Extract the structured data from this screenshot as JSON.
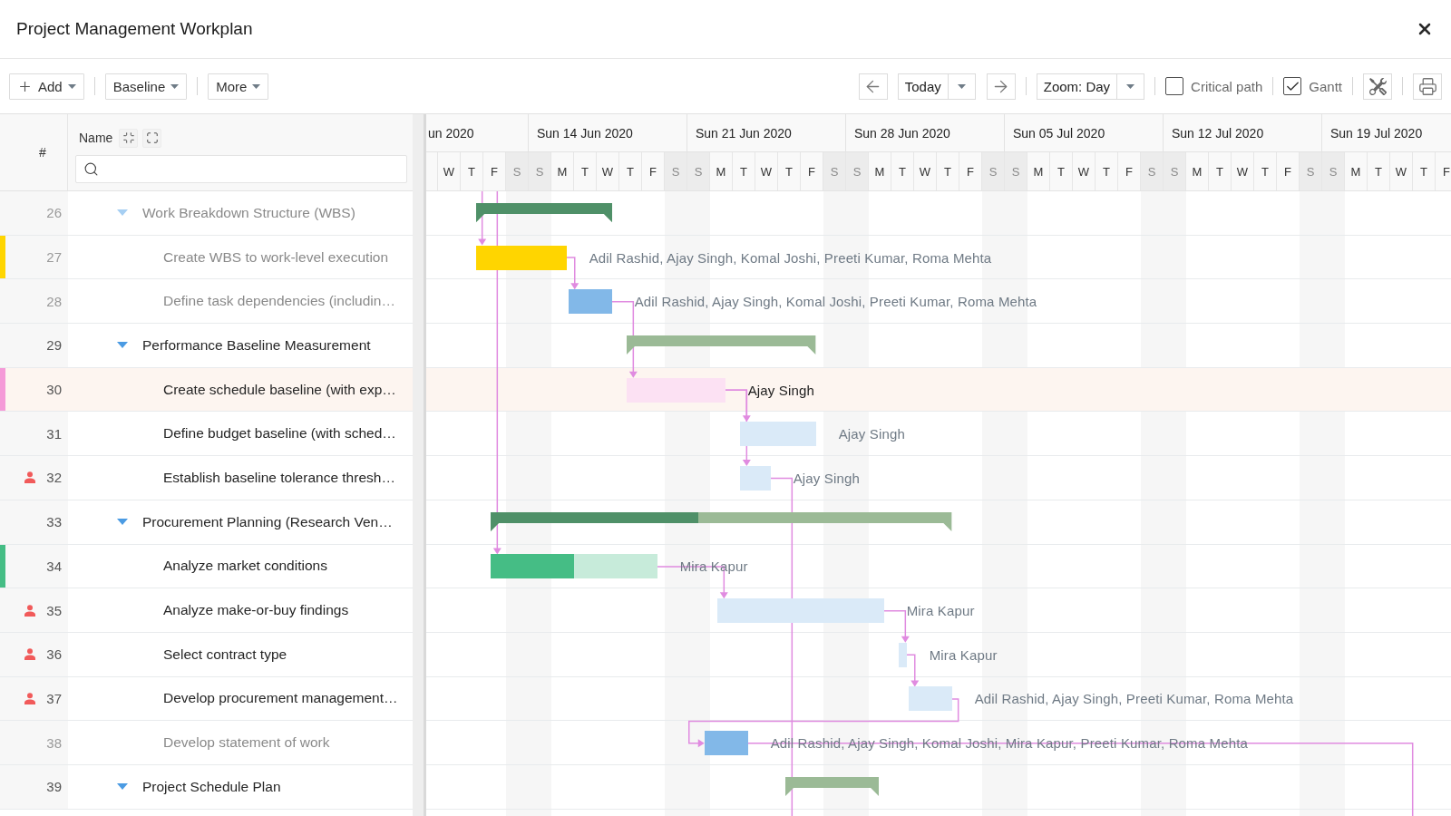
{
  "window": {
    "title": "Project Management Workplan"
  },
  "toolbar": {
    "buttons": [
      {
        "kind": "add",
        "label": "Add"
      },
      {
        "kind": "menu",
        "label": "Baseline"
      },
      {
        "kind": "menu",
        "label": "More"
      }
    ],
    "today": {
      "label": "Today"
    },
    "zoom": {
      "label": "Zoom: Day"
    },
    "checkboxes": [
      {
        "label": "Critical path",
        "checked": false
      },
      {
        "label": "Gantt",
        "checked": true
      }
    ]
  },
  "grid": {
    "columns": [
      "#",
      "Name"
    ]
  },
  "timeline": {
    "weeks": [
      "un 2020",
      "Sun 14 Jun 2020",
      "Sun 21 Jun 2020",
      "Sun 28 Jun 2020",
      "Sun 05 Jul 2020",
      "Sun 12 Jul 2020",
      "Sun 19 Jul 2020"
    ],
    "days": [
      {
        "letter": "W",
        "weekend": false
      },
      {
        "letter": "T",
        "weekend": false
      },
      {
        "letter": "F",
        "weekend": false
      },
      {
        "letter": "S",
        "weekend": true
      },
      {
        "letter": "S",
        "weekend": true
      },
      {
        "letter": "M",
        "weekend": false
      },
      {
        "letter": "T",
        "weekend": false
      },
      {
        "letter": "W",
        "weekend": false
      },
      {
        "letter": "T",
        "weekend": false
      },
      {
        "letter": "F",
        "weekend": false
      },
      {
        "letter": "S",
        "weekend": true
      },
      {
        "letter": "S",
        "weekend": true
      },
      {
        "letter": "M",
        "weekend": false
      },
      {
        "letter": "T",
        "weekend": false
      },
      {
        "letter": "W",
        "weekend": false
      },
      {
        "letter": "T",
        "weekend": false
      },
      {
        "letter": "F",
        "weekend": false
      },
      {
        "letter": "S",
        "weekend": true
      },
      {
        "letter": "S",
        "weekend": true
      },
      {
        "letter": "M",
        "weekend": false
      },
      {
        "letter": "T",
        "weekend": false
      },
      {
        "letter": "W",
        "weekend": false
      },
      {
        "letter": "T",
        "weekend": false
      },
      {
        "letter": "F",
        "weekend": false
      },
      {
        "letter": "S",
        "weekend": true
      },
      {
        "letter": "S",
        "weekend": true
      },
      {
        "letter": "M",
        "weekend": false
      },
      {
        "letter": "T",
        "weekend": false
      },
      {
        "letter": "W",
        "weekend": false
      },
      {
        "letter": "T",
        "weekend": false
      },
      {
        "letter": "F",
        "weekend": false
      },
      {
        "letter": "S",
        "weekend": true
      },
      {
        "letter": "S",
        "weekend": true
      },
      {
        "letter": "M",
        "weekend": false
      },
      {
        "letter": "T",
        "weekend": false
      },
      {
        "letter": "W",
        "weekend": false
      },
      {
        "letter": "T",
        "weekend": false
      },
      {
        "letter": "F",
        "weekend": false
      },
      {
        "letter": "S",
        "weekend": true
      },
      {
        "letter": "S",
        "weekend": true
      },
      {
        "letter": "M",
        "weekend": false
      },
      {
        "letter": "T",
        "weekend": false
      },
      {
        "letter": "W",
        "weekend": false
      },
      {
        "letter": "T",
        "weekend": false
      },
      {
        "letter": "F",
        "weekend": false
      }
    ]
  },
  "tasks": [
    {
      "number": "26",
      "name": "Work Breakdown Structure (WBS)",
      "kind": "summary",
      "expanded": true,
      "selected": false,
      "greyed": true,
      "resource_alert": false,
      "level": 1,
      "children": [
        {
          "number": "27",
          "name": "Create WBS to work-level execution",
          "kind": "task",
          "selected": false,
          "greyed": true,
          "resource_alert": false,
          "color": "#ffd500",
          "level": 1,
          "resources": "Adil Rashid, Ajay Singh, Komal Joshi, Preeti Kumar, Roma Mehta"
        },
        {
          "number": "28",
          "name": "Define task dependencies (includin…",
          "kind": "task",
          "selected": false,
          "greyed": true,
          "resource_alert": false,
          "level": 1,
          "resources": "Adil Rashid, Ajay Singh, Komal Joshi, Preeti Kumar, Roma Mehta"
        }
      ]
    },
    {
      "number": "29",
      "name": "Performance Baseline Measurement",
      "kind": "summary",
      "expanded": true,
      "selected": false,
      "greyed": false,
      "resource_alert": false,
      "children": [
        {
          "number": "30",
          "name": "Create schedule baseline (with exp…",
          "kind": "task",
          "selected": true,
          "greyed": false,
          "resource_alert": false,
          "color": "#f59ad8",
          "resources": "Ajay Singh"
        },
        {
          "number": "31",
          "name": "Define budget baseline (with sched…",
          "kind": "task",
          "selected": false,
          "greyed": false,
          "resource_alert": false,
          "resources": "Ajay Singh"
        },
        {
          "number": "32",
          "name": "Establish baseline tolerance thresh…",
          "kind": "task",
          "selected": false,
          "greyed": false,
          "resource_alert": true,
          "resources": "Ajay Singh"
        }
      ]
    },
    {
      "number": "33",
      "name": "Procurement Planning (Research Ven…",
      "kind": "summary",
      "expanded": true,
      "selected": false,
      "greyed": false,
      "resource_alert": false,
      "level": 0.45,
      "children": [
        {
          "number": "34",
          "name": "Analyze market conditions",
          "kind": "task",
          "selected": false,
          "greyed": false,
          "resource_alert": false,
          "color": "#45bd85",
          "level": 0.5,
          "resources": "Mira Kapur"
        },
        {
          "number": "35",
          "name": "Analyze make-or-buy findings",
          "kind": "task",
          "selected": false,
          "greyed": false,
          "resource_alert": true,
          "resources": "Mira Kapur"
        },
        {
          "number": "36",
          "name": "Select contract type",
          "kind": "task",
          "selected": false,
          "greyed": false,
          "resource_alert": true,
          "resources": "Mira Kapur"
        },
        {
          "number": "37",
          "name": "Develop procurement management…",
          "kind": "task",
          "selected": false,
          "greyed": false,
          "resource_alert": true,
          "resources": "Adil Rashid, Ajay Singh, Preeti Kumar, Roma Mehta"
        },
        {
          "number": "38",
          "name": "Develop statement of work",
          "kind": "task",
          "selected": false,
          "greyed": true,
          "resource_alert": false,
          "level": 1,
          "resources": "Adil Rashid, Ajay Singh, Komal Joshi, Mira Kapur, Preeti Kumar, Roma Mehta"
        }
      ]
    },
    {
      "number": "39",
      "name": "Project Schedule Plan",
      "kind": "summary",
      "expanded": true,
      "selected": false,
      "greyed": false,
      "resource_alert": false
    }
  ]
}
